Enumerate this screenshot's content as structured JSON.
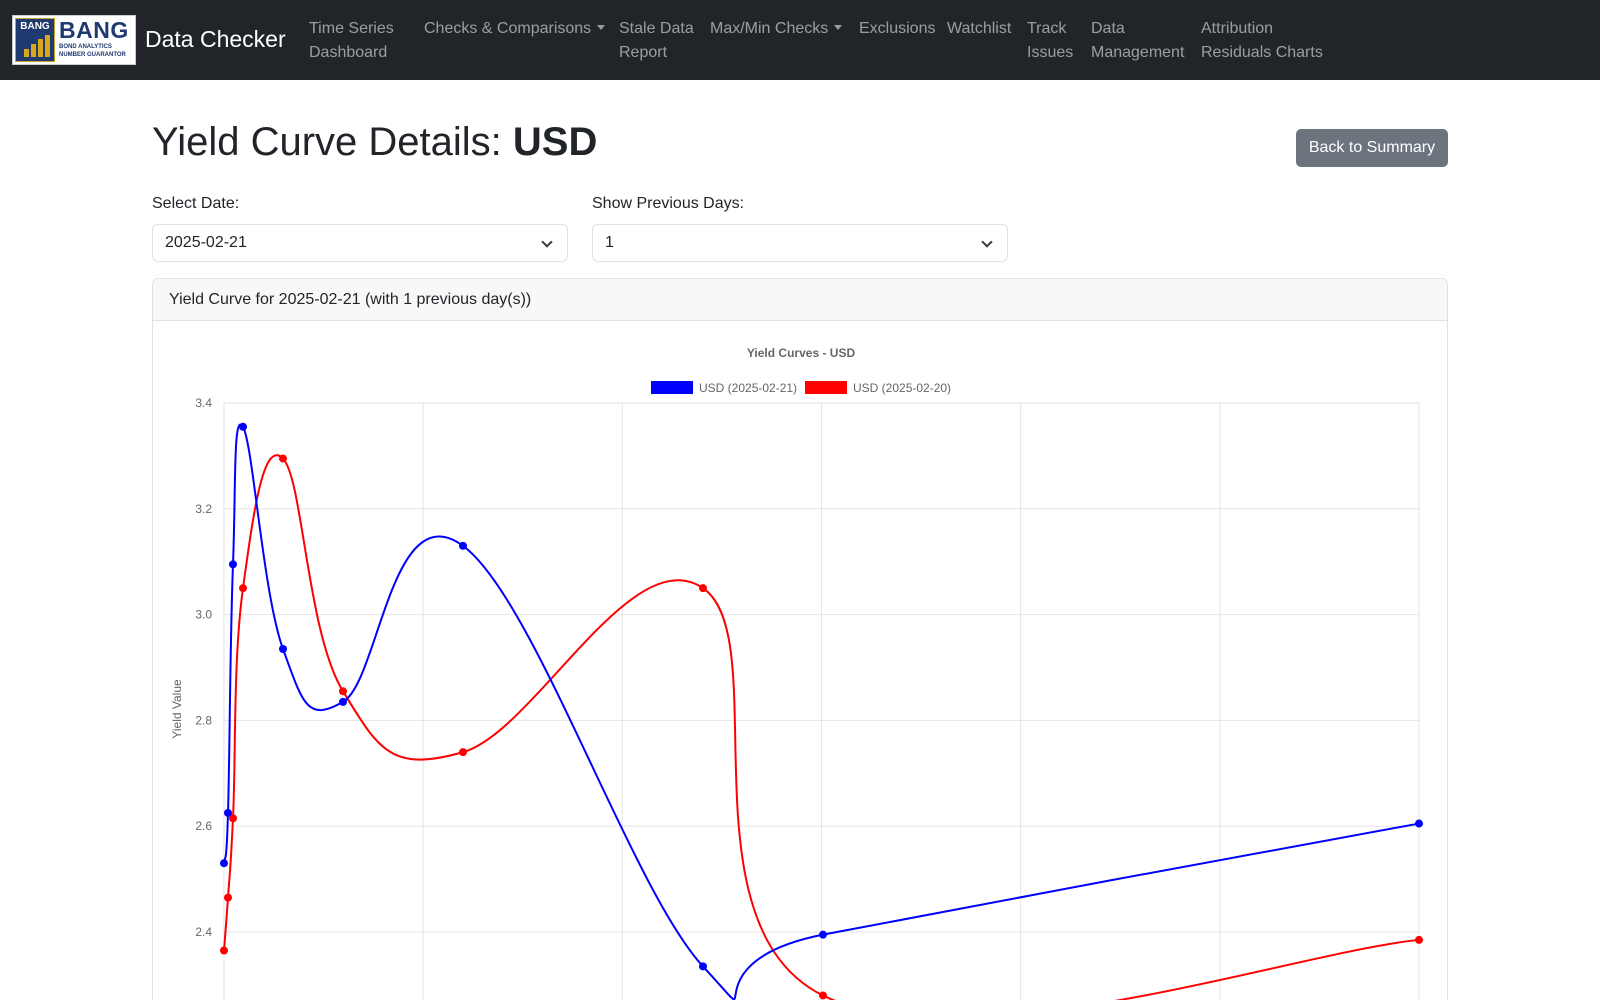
{
  "brand": {
    "logo_badge": "BANG",
    "logo_word": "BANG",
    "logo_sub": "BOND ANALYTICS NUMBER GUARANTOR",
    "name": "Data Checker"
  },
  "nav": [
    {
      "line1": "Time Series",
      "line2": "Dashboard",
      "dropdown": false
    },
    {
      "line1": "Checks & Comparisons",
      "line2": "",
      "dropdown": true
    },
    {
      "line1": "Stale Data",
      "line2": "Report",
      "dropdown": false
    },
    {
      "line1": "Max/Min Checks",
      "line2": "",
      "dropdown": true
    },
    {
      "line1": "Exclusions",
      "line2": "",
      "dropdown": false
    },
    {
      "line1": "Watchlist",
      "line2": "",
      "dropdown": false
    },
    {
      "line1": "Track",
      "line2": "Issues",
      "dropdown": false
    },
    {
      "line1": "Data",
      "line2": "Management",
      "dropdown": false
    },
    {
      "line1": "Attribution",
      "line2": "Residuals Charts",
      "dropdown": false
    }
  ],
  "header": {
    "title_prefix": "Yield Curve Details: ",
    "title_currency": "USD",
    "back_button": "Back to Summary"
  },
  "filters": {
    "date_label": "Select Date:",
    "date_value": "2025-02-21",
    "days_label": "Show Previous Days:",
    "days_value": "1"
  },
  "card": {
    "header": "Yield Curve for 2025-02-21 (with 1 previous day(s))"
  },
  "chart_data": {
    "type": "line",
    "title": "Yield Curves - USD",
    "xlabel": "",
    "ylabel": "Yield Value",
    "ylim": [
      2.3,
      3.4
    ],
    "yticks": [
      2.4,
      2.6,
      2.8,
      3.0,
      3.2,
      3.4
    ],
    "xlim": [
      0,
      30
    ],
    "grid": true,
    "legend_position": "top-center",
    "series": [
      {
        "name": "USD (2025-02-21)",
        "color": "#0000ff",
        "points": [
          [
            0.08,
            2.53
          ],
          [
            0.25,
            2.625
          ],
          [
            0.5,
            3.095
          ],
          [
            0.75,
            3.355
          ],
          [
            1.5,
            2.935
          ],
          [
            3,
            2.835
          ],
          [
            6,
            3.13
          ],
          [
            12,
            2.335
          ],
          [
            15,
            2.395
          ],
          [
            30,
            2.605
          ]
        ]
      },
      {
        "name": "USD (2025-02-20)",
        "color": "#ff0000",
        "points": [
          [
            0.08,
            2.365
          ],
          [
            0.25,
            2.465
          ],
          [
            0.5,
            2.615
          ],
          [
            0.75,
            3.05
          ],
          [
            1.5,
            3.295
          ],
          [
            3,
            2.855
          ],
          [
            6,
            2.74
          ],
          [
            12,
            3.05
          ],
          [
            15,
            2.28
          ],
          [
            30,
            2.385
          ]
        ]
      }
    ]
  }
}
